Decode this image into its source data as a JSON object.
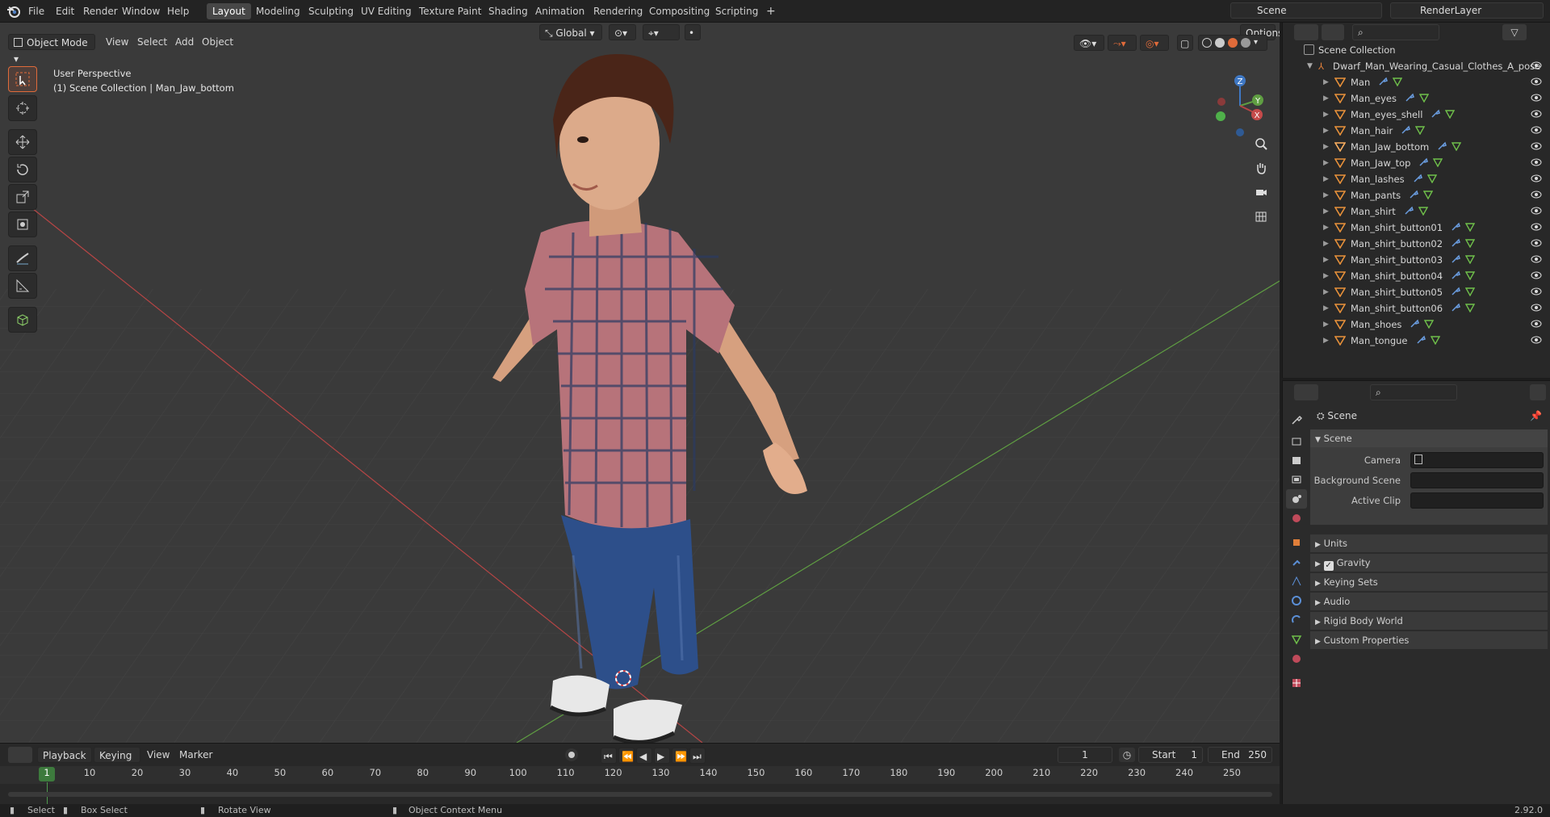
{
  "topbar": {
    "menus": [
      "File",
      "Edit",
      "Render",
      "Window",
      "Help"
    ],
    "workspaces": [
      "Layout",
      "Modeling",
      "Sculpting",
      "UV Editing",
      "Texture Paint",
      "Shading",
      "Animation",
      "Rendering",
      "Compositing",
      "Scripting"
    ],
    "active_workspace": "Layout",
    "add_workspace": "+",
    "scene_name": "Scene",
    "render_layer": "RenderLayer"
  },
  "viewport_header": {
    "mode": "Object Mode",
    "menus": [
      "View",
      "Select",
      "Add",
      "Object"
    ],
    "transform_orientation": "Global",
    "options_label": "Options"
  },
  "viewport": {
    "perspective_label": "User Perspective",
    "context_label": "(1) Scene Collection | Man_Jaw_bottom",
    "gizmo_axes": {
      "x": "X",
      "y": "Y",
      "z": "Z"
    },
    "colors": {
      "x_axis": "#b54545",
      "y_axis": "#5f9e42",
      "z_axis": "#3f78c4",
      "grid": "#444444",
      "background": "#3a3a3a",
      "accent": "#e06b3a"
    }
  },
  "outliner": {
    "root": "Scene Collection",
    "collection": "Dwarf_Man_Wearing_Casual_Clothes_A_pose",
    "objects": [
      "Man",
      "Man_eyes",
      "Man_eyes_shell",
      "Man_hair",
      "Man_Jaw_bottom",
      "Man_Jaw_top",
      "Man_lashes",
      "Man_pants",
      "Man_shirt",
      "Man_shirt_button01",
      "Man_shirt_button02",
      "Man_shirt_button03",
      "Man_shirt_button04",
      "Man_shirt_button05",
      "Man_shirt_button06",
      "Man_shoes",
      "Man_tongue"
    ],
    "selected": "Man_Jaw_bottom"
  },
  "properties": {
    "context_title": "Scene",
    "section_scene": "Scene",
    "camera_label": "Camera",
    "background_scene_label": "Background Scene",
    "active_clip_label": "Active Clip",
    "sections": [
      "Units",
      "Gravity",
      "Keying Sets",
      "Audio",
      "Rigid Body World",
      "Custom Properties"
    ],
    "gravity_checked": true
  },
  "timeline": {
    "menus": [
      "Playback",
      "Keying",
      "View",
      "Marker"
    ],
    "current_frame": "1",
    "start_label": "Start",
    "start_value": "1",
    "end_label": "End",
    "end_value": "250",
    "ruler": [
      "1",
      "10",
      "20",
      "30",
      "40",
      "50",
      "60",
      "70",
      "80",
      "90",
      "100",
      "110",
      "120",
      "130",
      "140",
      "150",
      "160",
      "170",
      "180",
      "190",
      "200",
      "210",
      "220",
      "230",
      "240",
      "250"
    ]
  },
  "statusbar": {
    "select": "Select",
    "box_select": "Box Select",
    "rotate_view": "Rotate View",
    "context_menu": "Object Context Menu",
    "version": "2.92.0"
  }
}
